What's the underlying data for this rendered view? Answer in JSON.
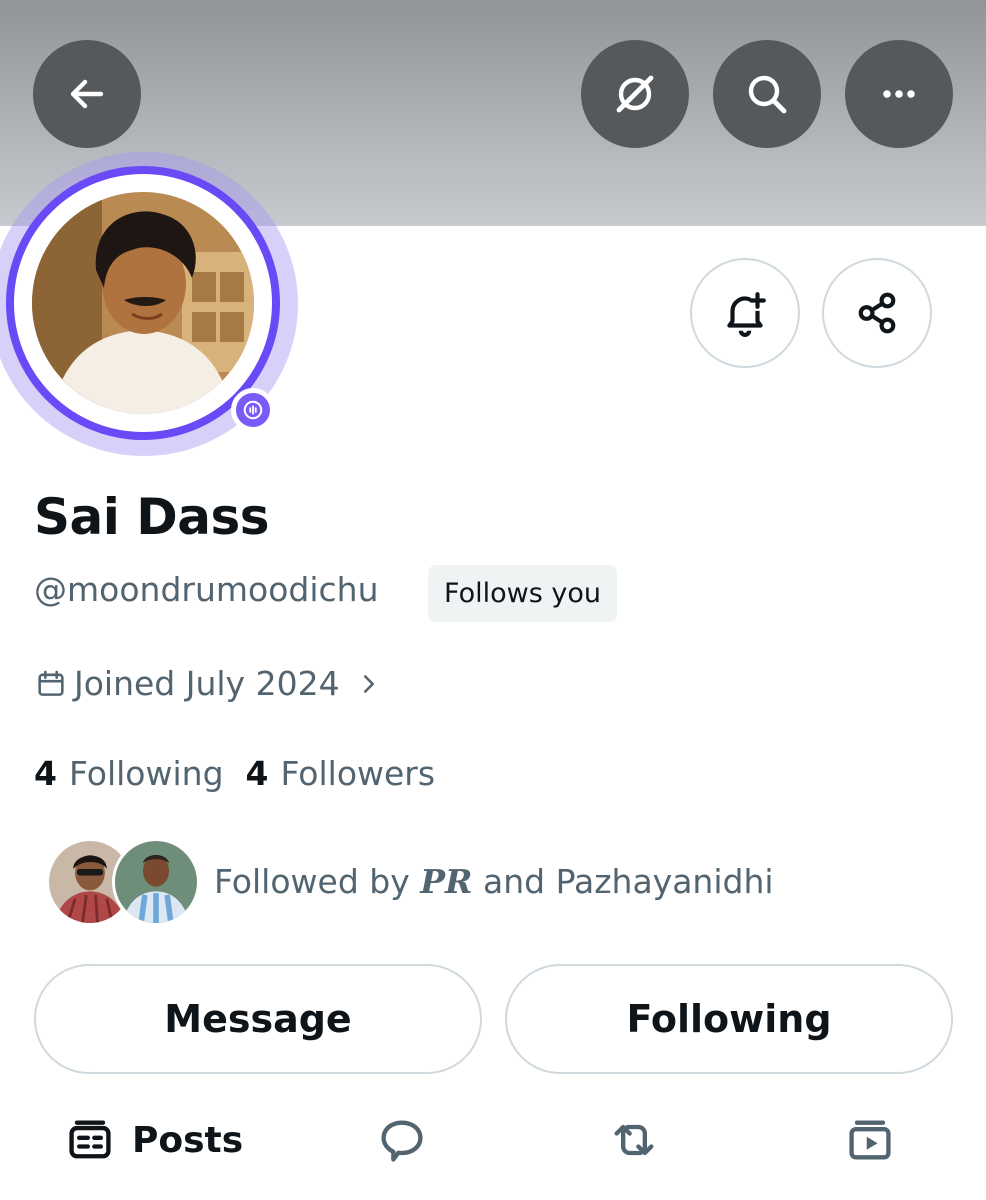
{
  "header": {
    "back_icon": "arrow-left-icon",
    "grok_icon": "grok-icon",
    "search_icon": "search-icon",
    "more_icon": "more-horizontal-icon"
  },
  "profile": {
    "name": "Sai Dass",
    "handle": "@moondrumoodichu",
    "follows_you": "Follows you",
    "joined": "Joined July 2024",
    "following_count": "4",
    "following_label": "Following",
    "followers_count": "4",
    "followers_label": "Followers"
  },
  "followed_by": {
    "prefix": "Followed by",
    "first": "PR",
    "joiner": "and",
    "second": "Pazhayanidhi"
  },
  "actions": {
    "notify_icon": "bell-plus-icon",
    "share_icon": "share-icon",
    "message_label": "Message",
    "following_label": "Following"
  },
  "tabs": {
    "posts_label": "Posts"
  },
  "colors": {
    "accent_ring": "#6a4af6",
    "space_badge": "#7a5af8",
    "text_primary": "#0f1419",
    "text_secondary": "#536471",
    "border": "#cfd9de"
  }
}
